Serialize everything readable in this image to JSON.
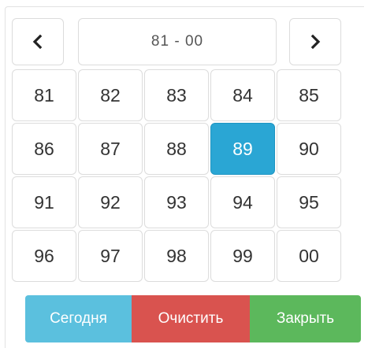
{
  "header": {
    "range": "81 - 00",
    "prev_icon": "chevron-left-icon",
    "next_icon": "chevron-right-icon"
  },
  "years": [
    [
      "81",
      "82",
      "83",
      "84",
      "85"
    ],
    [
      "86",
      "87",
      "88",
      "89",
      "90"
    ],
    [
      "91",
      "92",
      "93",
      "94",
      "95"
    ],
    [
      "96",
      "97",
      "98",
      "99",
      "00"
    ]
  ],
  "selected_year": "89",
  "buttons": {
    "today": "Сегодня",
    "clear": "Очистить",
    "close": "Закрыть"
  },
  "colors": {
    "selected": "#2aa6d4",
    "today": "#5bc0de",
    "clear": "#d9534f",
    "close": "#5cb85c"
  }
}
